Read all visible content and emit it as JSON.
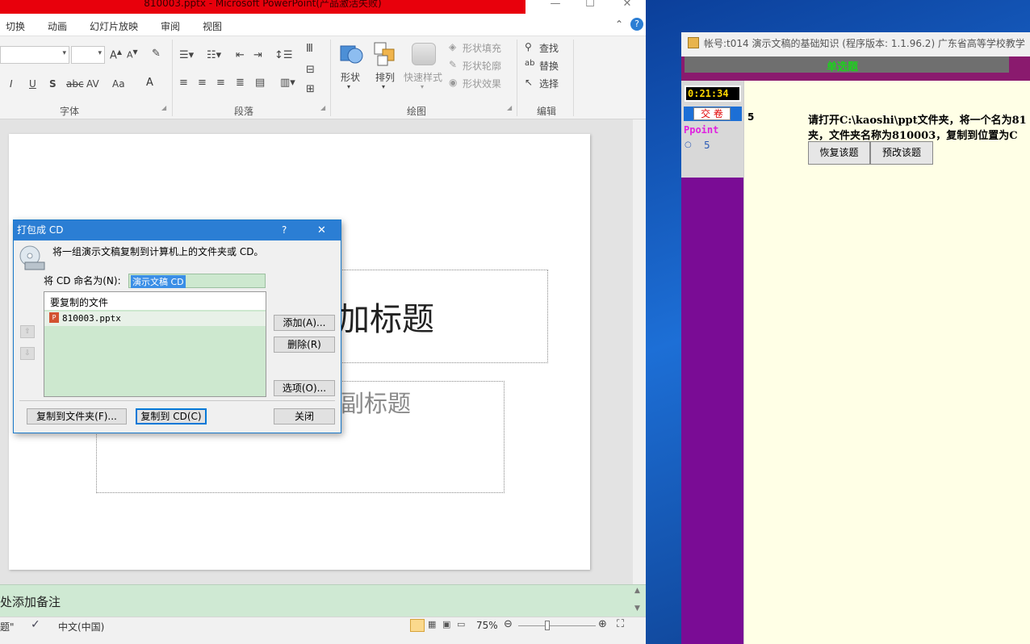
{
  "powerpoint": {
    "window_title": "810003.pptx - Microsoft PowerPoint(产品激活失败)",
    "window_controls": {
      "minimize": "—",
      "maximize": "☐",
      "close": "✕"
    },
    "menu": [
      "切换",
      "动画",
      "幻灯片放映",
      "审阅",
      "视图"
    ],
    "ribbon": {
      "font_group_label": "字体",
      "paragraph_group_label": "段落",
      "drawing_group_label": "绘图",
      "editing_group_label": "编辑",
      "shape_label": "形状",
      "arrange_label": "排列",
      "quick_styles_label": "快速样式",
      "shape_fill": "形状填充",
      "shape_outline": "形状轮廓",
      "shape_effects": "形状效果",
      "find": "查找",
      "replace": "替换",
      "select": "选择",
      "font_buttons": [
        "I",
        "U",
        "S",
        "abc",
        "AV",
        "Aa",
        "A"
      ]
    },
    "slide": {
      "title_placeholder": "加标题",
      "subtitle_placeholder": "副标题"
    },
    "notes_placeholder": "处添加备注",
    "status": {
      "slide_info": "题\"",
      "language": "中文(中国)",
      "zoom": "75%"
    }
  },
  "dialog": {
    "title": "打包成 CD",
    "help": "?",
    "close": "✕",
    "description": "将一组演示文稿复制到计算机上的文件夹或 CD。",
    "name_label": "将 CD 命名为(N):",
    "name_value": "演示文稿 CD",
    "files_header": "要复制的文件",
    "files": [
      "810003.pptx"
    ],
    "add_button": "添加(A)...",
    "remove_button": "删除(R)",
    "options_button": "选项(O)...",
    "copy_folder_button": "复制到文件夹(F)...",
    "copy_cd_button": "复制到 CD(C)",
    "close_button": "关闭"
  },
  "exam": {
    "window_title": "帐号:t014 演示文稿的基础知识 (程序版本: 1.1.96.2) 广东省高等学校教学",
    "question_type": "单选题",
    "timer": "0:21:34",
    "submit": "交 卷",
    "ppoint_label": "Ppoint",
    "ppoint_item": "5",
    "question_number": "5",
    "question_text_line1": "请打开C:\\kaoshi\\ppt文件夹，将一个名为81",
    "question_text_line2": "夹，文件夹名称为810003，复制到位置为C",
    "restore_button": "恢复该题",
    "preview_button": "预改该题"
  },
  "colors": {
    "title_red": "#e8000c",
    "dialog_blue": "#2b7ed4",
    "exam_purple": "#7a0c95",
    "list_green": "#cde8cf"
  }
}
